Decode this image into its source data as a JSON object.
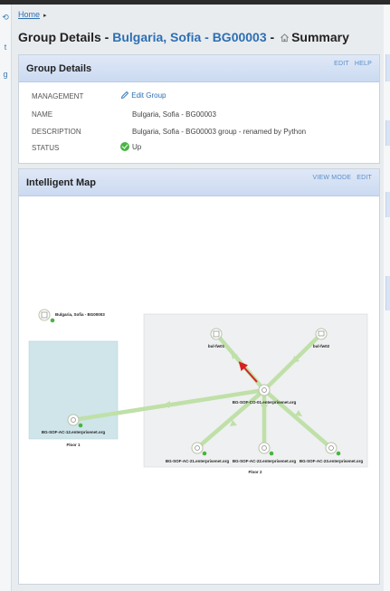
{
  "breadcrumb": {
    "home": "Home",
    "separator": "▸"
  },
  "title": {
    "prefix": "Group Details - ",
    "group": "Bulgaria, Sofia - BG00003",
    "dash": " - ",
    "summary": "Summary"
  },
  "group_details": {
    "heading": "Group Details",
    "links": [
      "EDIT",
      "HELP"
    ],
    "rows": [
      {
        "label": "MANAGEMENT",
        "value": "Edit Group"
      },
      {
        "label": "NAME",
        "value": "Bulgaria, Sofia - BG00003"
      },
      {
        "label": "DESCRIPTION",
        "value": "Bulgaria, Sofia - BG00003 group - renamed by Python"
      },
      {
        "label": "STATUS",
        "value": "Up"
      }
    ]
  },
  "map": {
    "heading": "Intelligent Map",
    "links": [
      "VIEW MODE",
      "EDIT"
    ],
    "group_node": "Bulgaria, Sofia - BG00003",
    "floor1_label": "Floor 1",
    "floor2_label": "Floor 2",
    "nodes": {
      "ac12": "BG-SOF-AC-12.enterprisenet.org",
      "fw01": "bul-fw01",
      "fw02": "bul-fw02",
      "co01": "BG-SOF-CO-01.enterprisenet.org",
      "ac21": "BG-SOF-AC-21.enterprisenet.org",
      "ac22": "BG-SOF-AC-22.enterprisenet.org",
      "ac23": "BG-SOF-AC-23.enterprisenet.org"
    },
    "colors": {
      "link": "#bfe0a8",
      "alert_link": "#d92020",
      "status_up": "#49b543"
    }
  },
  "left_rail": [
    "⟲",
    "t",
    "g"
  ]
}
